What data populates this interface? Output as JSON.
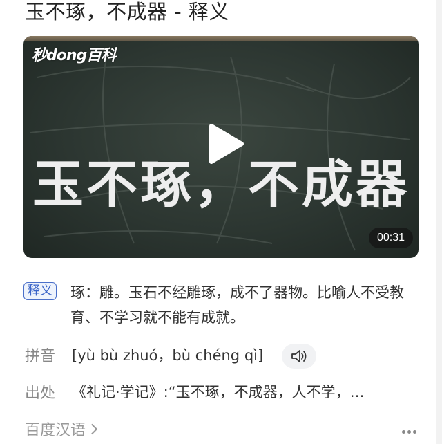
{
  "page": {
    "title": "玉不琢，不成器 - 释义"
  },
  "video": {
    "logo_text": "秒dong百科",
    "overlay_text": "玉不琢，不成器",
    "duration": "00:31",
    "play_icon": "play-icon"
  },
  "definition": {
    "tag": "释义",
    "text": "琢：雕。玉石不经雕琢，成不了器物。比喻人不受教育、不学习就不能有成就。"
  },
  "pinyin": {
    "label": "拼音",
    "text": "[yù bù zhuó，bù chéng qì]",
    "audio_icon": "speaker-icon"
  },
  "source": {
    "label": "出处",
    "text": "《礼记·学记》:“玉不琢，不成器，人不学，…"
  },
  "footer": {
    "link_text": "百度汉语",
    "more_icon": "more-icon"
  }
}
